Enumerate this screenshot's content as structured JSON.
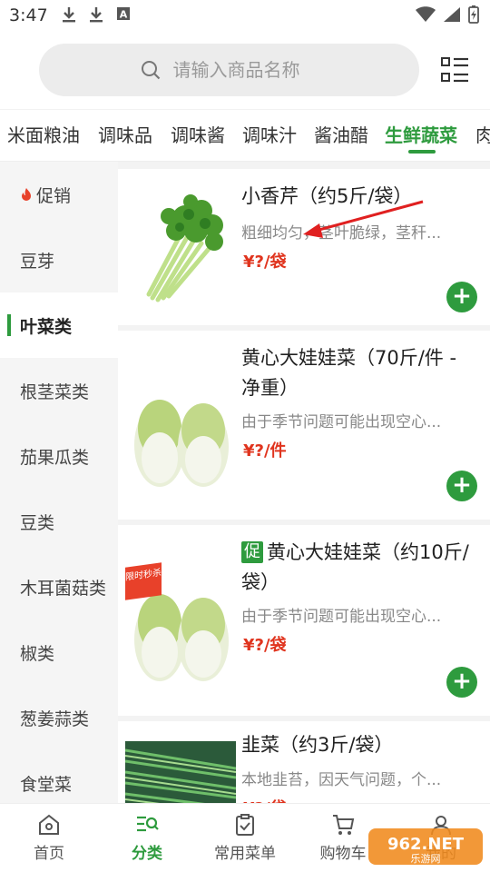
{
  "status_bar": {
    "time": "3:47",
    "left_icons": [
      "download-icon",
      "download-icon",
      "a-icon"
    ]
  },
  "search": {
    "placeholder": "请输入商品名称"
  },
  "category_tabs": [
    {
      "label": "米面粮油",
      "active": false
    },
    {
      "label": "调味品",
      "active": false
    },
    {
      "label": "调味酱",
      "active": false
    },
    {
      "label": "调味汁",
      "active": false
    },
    {
      "label": "酱油醋",
      "active": false
    },
    {
      "label": "生鲜蔬菜",
      "active": true
    },
    {
      "label": "肉",
      "active": false
    }
  ],
  "sidebar": [
    {
      "label": "促销",
      "hot": true
    },
    {
      "label": "豆芽"
    },
    {
      "label": "叶菜类",
      "active": true
    },
    {
      "label": "根茎菜类"
    },
    {
      "label": "茄果瓜类"
    },
    {
      "label": "豆类"
    },
    {
      "label": "木耳菌菇类"
    },
    {
      "label": "椒类"
    },
    {
      "label": "葱姜蒜类"
    },
    {
      "label": "食堂菜"
    }
  ],
  "products": [
    {
      "title": "小香芹（约5斤/袋）",
      "desc": "粗细均匀，茎叶脆绿，茎秆...",
      "price": "¥?/袋",
      "promo": false
    },
    {
      "title": "黄心大娃娃菜（70斤/件 - 净重）",
      "desc": "由于季节问题可能出现空心...",
      "price": "¥?/件",
      "promo": false
    },
    {
      "title": "黄心大娃娃菜（约10斤/袋）",
      "promo_tag": "促",
      "ribbon": "限时秒杀",
      "desc": "由于季节问题可能出现空心...",
      "price": "¥?/袋",
      "promo": true
    },
    {
      "title": "韭菜（约3斤/袋）",
      "desc": "本地韭苔，因天气问题，个...",
      "price": "¥?/袋",
      "promo": false
    }
  ],
  "bottom_nav": [
    {
      "label": "首页",
      "icon": "home-icon"
    },
    {
      "label": "分类",
      "icon": "category-icon",
      "active": true
    },
    {
      "label": "常用菜单",
      "icon": "clipboard-icon"
    },
    {
      "label": "购物车",
      "icon": "cart-icon"
    },
    {
      "label": "我的",
      "icon": "user-icon"
    }
  ],
  "watermark": {
    "text": "962.NET 乐游网"
  },
  "colors": {
    "accent": "#2e9b3e",
    "price": "#e0341e",
    "annotation_arrow": "#e02020"
  }
}
